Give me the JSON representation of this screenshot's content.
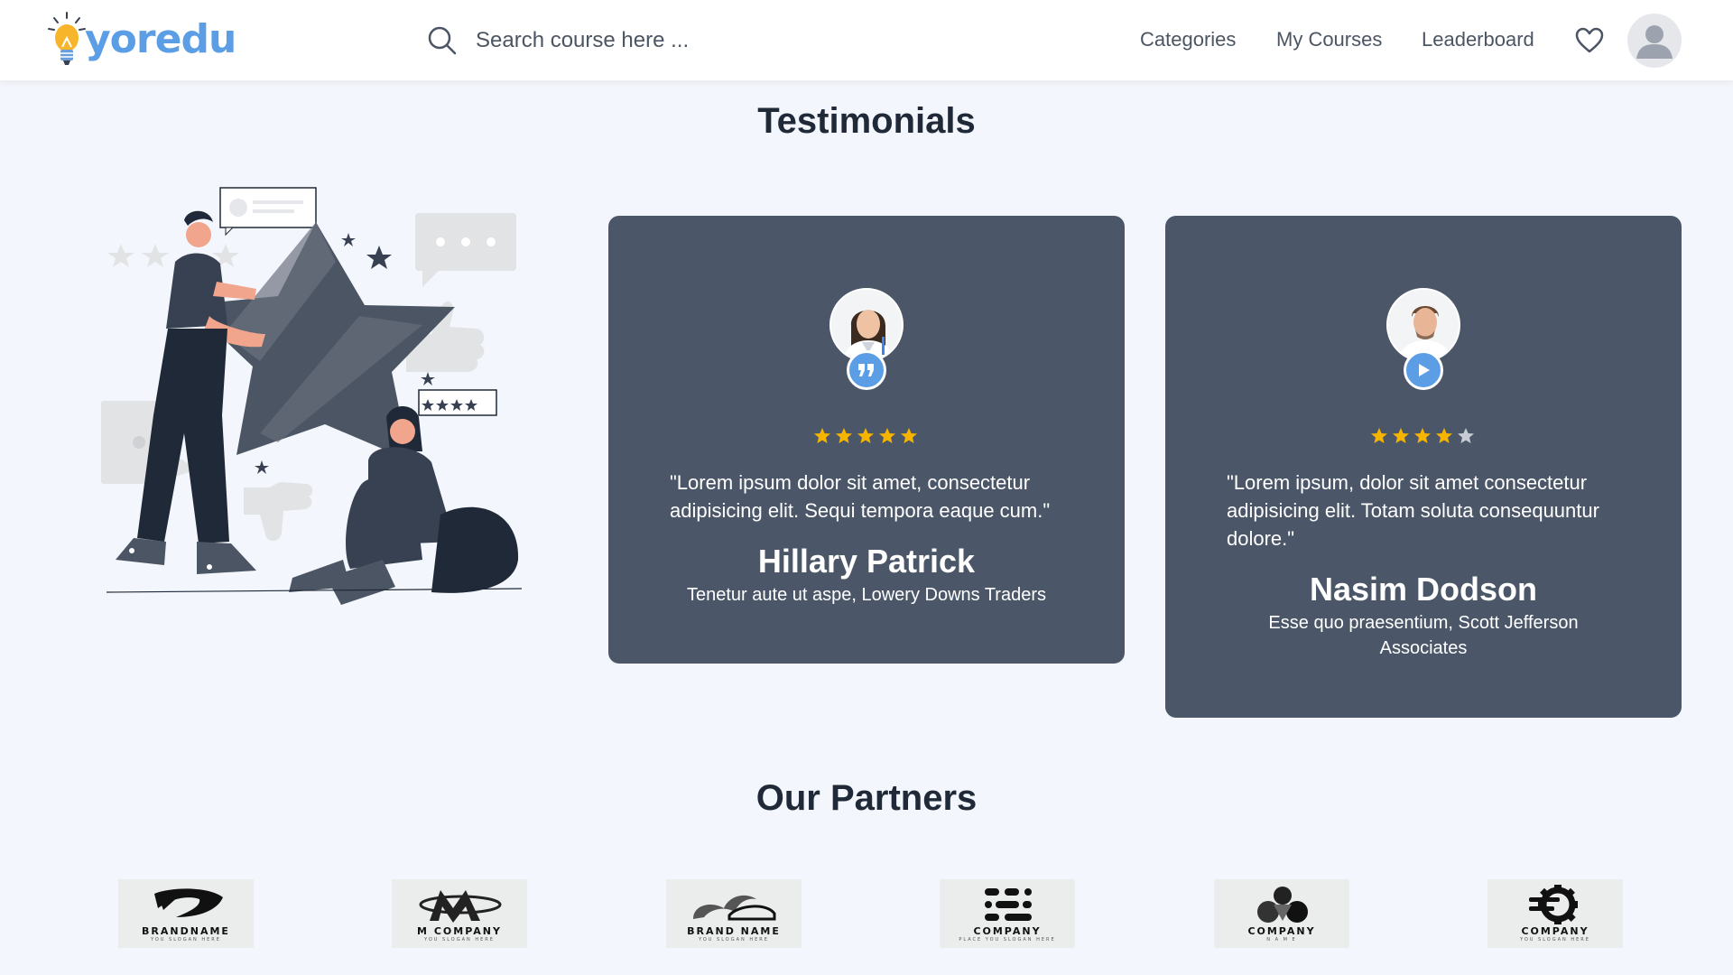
{
  "header": {
    "logo_text": "yoredu",
    "search_placeholder": "Search course here ...",
    "nav": [
      {
        "label": "Categories"
      },
      {
        "label": "My Courses"
      },
      {
        "label": "Leaderboard"
      }
    ]
  },
  "testimonials": {
    "title": "Testimonials",
    "cards": [
      {
        "rating": 5,
        "quote": "\"Lorem ipsum dolor sit amet, consectetur adipisicing elit. Sequi tempora eaque cum.\"",
        "name": "Hillary Patrick",
        "role": "Tenetur aute ut aspe, Lowery Downs Traders",
        "badge": "quote-icon"
      },
      {
        "rating": 4,
        "quote": "\"Lorem ipsum, dolor sit amet consectetur adipisicing elit. Totam soluta consequuntur dolore.\"",
        "name": "Nasim Dodson",
        "role": "Esse quo praesentium, Scott Jefferson Associates",
        "badge": "play-icon"
      }
    ]
  },
  "partners": {
    "title": "Our Partners",
    "logos": [
      {
        "name": "BRANDNAME",
        "slogan": "YOU SLOGAN HERE"
      },
      {
        "name": "M COMPANY",
        "slogan": "YOU SLOGAN HERE"
      },
      {
        "name": "BRAND NAME",
        "slogan": "YOU SLOGAN HERE"
      },
      {
        "name": "COMPANY",
        "slogan": "PLACE YOU SLOGAN HERE"
      },
      {
        "name": "COMPANY",
        "slogan": "N A M E"
      },
      {
        "name": "COMPANY",
        "slogan": "YOU SLOGAN HERE"
      }
    ]
  },
  "colors": {
    "brand": "#5c9ee6",
    "card_bg": "#4b5768",
    "star_filled": "#f5b400",
    "star_empty": "#c7ccd4",
    "page_bg": "#f3f6fc"
  }
}
